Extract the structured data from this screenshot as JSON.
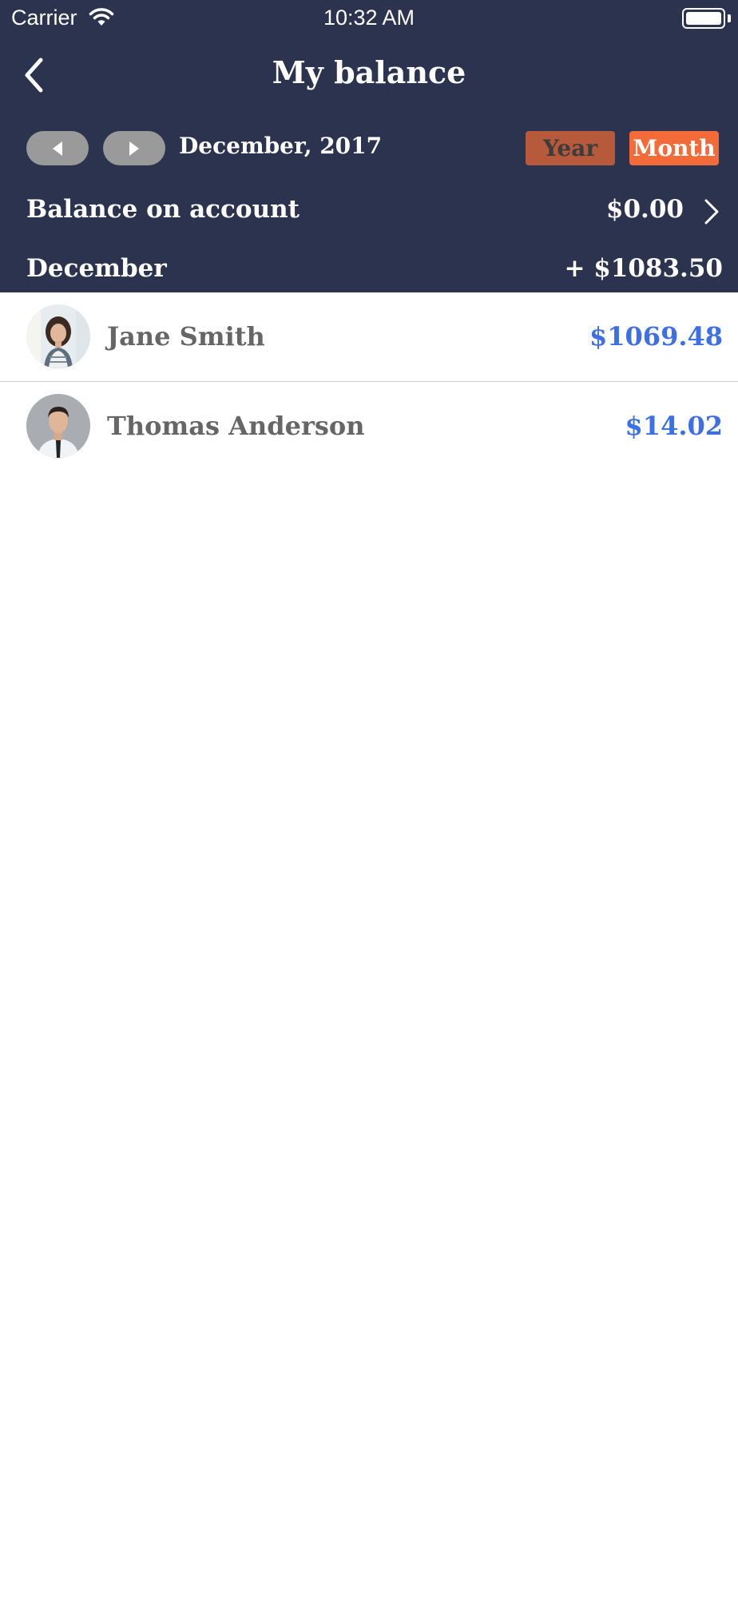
{
  "status_bar": {
    "carrier": "Carrier",
    "time": "10:32 AM",
    "icons": [
      "wifi-icon",
      "battery-icon"
    ]
  },
  "nav": {
    "title": "My balance",
    "back_icon": "chevron-left-icon"
  },
  "period": {
    "label": "December, 2017",
    "prev_icon": "triangle-left-icon",
    "next_icon": "triangle-right-icon",
    "year_label": "Year",
    "month_label": "Month",
    "selected": "Month"
  },
  "balance": {
    "label": "Balance on account",
    "value": "$0.00",
    "chevron_icon": "chevron-right-icon"
  },
  "summary": {
    "month": "December",
    "total": "+ $1083.50"
  },
  "people": [
    {
      "name": "Jane Smith",
      "amount": "$1069.48"
    },
    {
      "name": "Thomas Anderson",
      "amount": "$14.02"
    }
  ],
  "colors": {
    "header_bg": "#2c334f",
    "year_button": "#b75a3c",
    "month_button": "#f46b3a",
    "amount_text": "#3d6fe6",
    "name_text": "#666666",
    "pill_button": "#9a9a9a"
  }
}
